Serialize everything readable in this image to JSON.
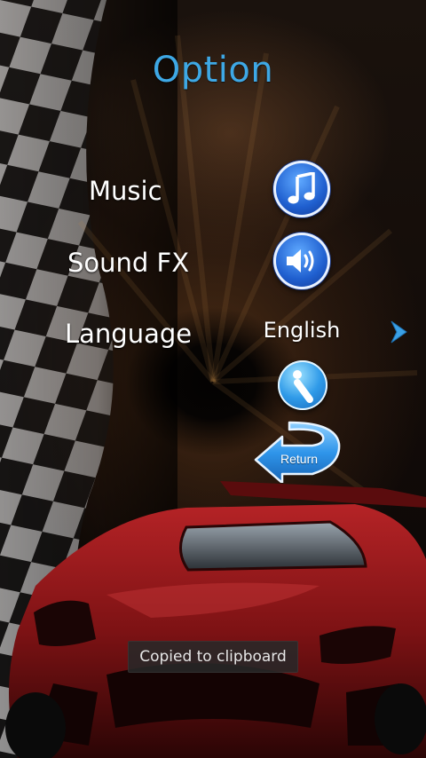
{
  "title": "Option",
  "rows": {
    "music": {
      "label": "Music",
      "icon": "music-note-icon"
    },
    "sound_fx": {
      "label": "Sound FX",
      "icon": "speaker-icon"
    },
    "language": {
      "label": "Language",
      "value": "English",
      "next_icon": "chevron-right-icon"
    }
  },
  "info_icon": "info-icon",
  "return_button": {
    "label": "Return",
    "icon": "return-arrow-icon"
  },
  "toast": "Copied to clipboard",
  "colors": {
    "title": "#3ea8e5",
    "button_blue": "#1f5fcf",
    "chevron": "#3aa0e6",
    "car_red": "#8a1618"
  }
}
